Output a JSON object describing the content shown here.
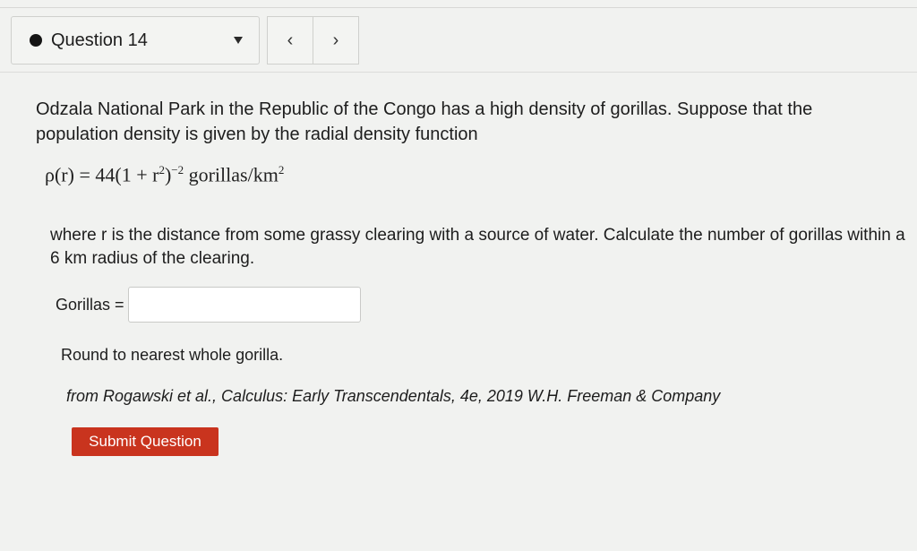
{
  "question_nav": {
    "label": "Question 14",
    "prev_symbol": "‹",
    "next_symbol": "›"
  },
  "question": {
    "prompt": "Odzala National Park in the Republic of the Congo has a high density of gorillas. Suppose that the population density is given by the radial density function",
    "formula": {
      "lhs": "ρ(r) = 44(1 + r",
      "inner_exp": "2",
      "close": ")",
      "outer_exp": "−2",
      "unit": " gorillas/km",
      "unit_exp": "2"
    },
    "description": "where r is the distance from some grassy clearing with a source of water. Calculate the number of gorillas within a 6 km radius of the clearing.",
    "answer_label": "Gorillas =",
    "answer_value": "",
    "round_note": "Round to nearest whole gorilla.",
    "citation": "from Rogawski et al., Calculus: Early Transcendentals, 4e, 2019 W.H. Freeman & Company"
  },
  "submit": {
    "label": "Submit Question"
  },
  "colors": {
    "submit_bg": "#c9341e",
    "page_bg": "#f1f2f0"
  }
}
